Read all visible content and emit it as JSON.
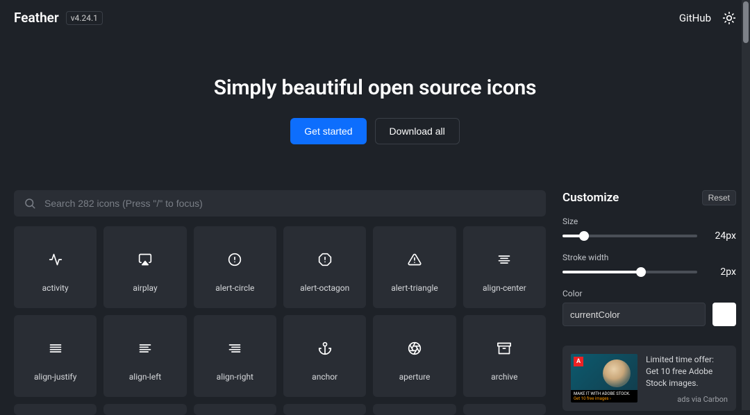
{
  "header": {
    "logo": "Feather",
    "version": "v4.24.1",
    "github": "GitHub"
  },
  "hero": {
    "title": "Simply beautiful open source icons",
    "get_started": "Get started",
    "download_all": "Download all"
  },
  "search": {
    "placeholder": "Search 282 icons (Press \"/\" to focus)"
  },
  "icons": [
    {
      "name": "activity"
    },
    {
      "name": "airplay"
    },
    {
      "name": "alert-circle"
    },
    {
      "name": "alert-octagon"
    },
    {
      "name": "alert-triangle"
    },
    {
      "name": "align-center"
    },
    {
      "name": "align-justify"
    },
    {
      "name": "align-left"
    },
    {
      "name": "align-right"
    },
    {
      "name": "anchor"
    },
    {
      "name": "aperture"
    },
    {
      "name": "archive"
    }
  ],
  "customize": {
    "title": "Customize",
    "reset": "Reset",
    "size_label": "Size",
    "size_value": "24px",
    "stroke_label": "Stroke width",
    "stroke_value": "2px",
    "color_label": "Color",
    "color_value": "currentColor"
  },
  "ad": {
    "text": "Limited time offer: Get 10 free Adobe Stock images.",
    "via": "ads via Carbon",
    "img_line1": "MAKE IT WITH ADOBE STOCK.",
    "img_line2": "Get 10 free images ›"
  }
}
